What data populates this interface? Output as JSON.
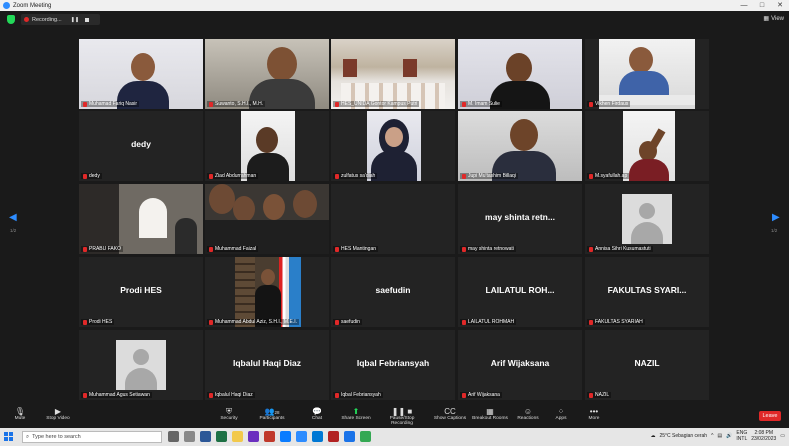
{
  "window": {
    "title": "Zoom Meeting",
    "controls": [
      "—",
      "□",
      "✕"
    ]
  },
  "meeting": {
    "recording_label": "Recording...",
    "view_label": "View",
    "page_left": "1/2",
    "page_right": "1/2"
  },
  "tiles": [
    {
      "name": "Muhamad Fariq Nasir",
      "big": ""
    },
    {
      "name": "Suwanto, S.H.I., M.H.",
      "big": ""
    },
    {
      "name": "HES_UNIDA Gontor Kampus Putri",
      "big": ""
    },
    {
      "name": "M. Imam Sulie",
      "big": "",
      "active": true
    },
    {
      "name": "Vikhen Firdaus",
      "big": ""
    },
    {
      "name": "dedy",
      "big": "dedy"
    },
    {
      "name": "Ziad Abdurrahman",
      "big": ""
    },
    {
      "name": "zulfatus sa'diah",
      "big": ""
    },
    {
      "name": "Jupi Mu'tashim Billaqi",
      "big": ""
    },
    {
      "name": "M.syafullah.ap",
      "big": ""
    },
    {
      "name": "PRABU FAKO",
      "big": ""
    },
    {
      "name": "Muhammad Faizal",
      "big": ""
    },
    {
      "name": "HES Mantingan",
      "big": ""
    },
    {
      "name": "may shinta retnowati",
      "big": "may shinta retn..."
    },
    {
      "name": "Annisa Sihri Kusumastuti",
      "big": ""
    },
    {
      "name": "Prodi HES",
      "big": "Prodi HES"
    },
    {
      "name": "Muhammad Abdul Aziz, S.H.I., M.E.I.",
      "big": ""
    },
    {
      "name": "saefudin",
      "big": "saefudin"
    },
    {
      "name": "LAILATUL ROHMAH",
      "big": "LAILATUL ROH..."
    },
    {
      "name": "FAKULTAS SYARIAH",
      "big": "FAKULTAS SYARI..."
    },
    {
      "name": "Muhammad Agus Setiawan",
      "big": ""
    },
    {
      "name": "Iqbalul Haqi Diaz",
      "big": "Iqbalul Haqi Diaz"
    },
    {
      "name": "Iqbal Febriansyah",
      "big": "Iqbal Febriansyah"
    },
    {
      "name": "Arif Wijaksana",
      "big": "Arif Wijaksana"
    },
    {
      "name": "NAZIL",
      "big": "NAZIL"
    }
  ],
  "toolbar": {
    "mute": "Mute",
    "stop_video": "Stop Video",
    "security": "Security",
    "participants": "Participants",
    "participants_count": "28",
    "chat": "Chat",
    "share": "Share Screen",
    "record": "Pause/Stop Recording",
    "captions": "Show Captions",
    "breakout": "Breakout Rooms",
    "reactions": "Reactions",
    "apps": "Apps",
    "more": "More",
    "leave": "Leave"
  },
  "taskbar": {
    "search_placeholder": "Type here to search",
    "weather": "25°C  Sebagian cerah",
    "lang": "ENG",
    "region": "INTL",
    "time": "2:08 PM",
    "date": "23/02/2023"
  },
  "colors": {
    "accent": "#2d8cff",
    "active_border": "#b7e33c",
    "leave": "#e02828",
    "share": "#23d959"
  }
}
